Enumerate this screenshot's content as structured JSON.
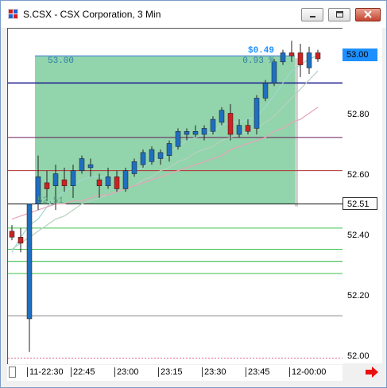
{
  "window": {
    "title": "S.CSX - CSX Corporation, 3 Min",
    "icon": "chart-app-icon",
    "controls": [
      "minimize-icon",
      "maximize-icon",
      "close-icon"
    ]
  },
  "chart": {
    "profit_label": "$0.49",
    "percent_label": "0.93 %",
    "start_price_label": "53.00",
    "entry_price_label": "52.51",
    "price_flag": "53.00",
    "last_price_flag": "52.51",
    "price_flag_color": "#1e90ff",
    "profit_zone_color": "#7fcc9e",
    "bullish_color": "#1f6fc0",
    "bearish_color": "#cc2222"
  },
  "chart_data": {
    "type": "candlestick",
    "ylim": [
      51.98,
      53.09
    ],
    "yticks": [
      "53.00",
      "52.80",
      "52.60",
      "52.40",
      "52.20",
      "52.00"
    ],
    "xticks": [
      "11-22:30",
      "22:45",
      "23:00",
      "23:15",
      "23:30",
      "23:45",
      "12-00:00"
    ],
    "candles": [
      {
        "o": 52.42,
        "h": 52.44,
        "l": 52.39,
        "c": 52.4
      },
      {
        "o": 52.4,
        "h": 52.43,
        "l": 52.35,
        "c": 52.38
      },
      {
        "o": 52.13,
        "h": 52.51,
        "l": 52.02,
        "c": 52.51
      },
      {
        "o": 52.51,
        "h": 52.67,
        "l": 52.49,
        "c": 52.6
      },
      {
        "o": 52.58,
        "h": 52.62,
        "l": 52.52,
        "c": 52.56
      },
      {
        "o": 52.57,
        "h": 52.64,
        "l": 52.49,
        "c": 52.61
      },
      {
        "o": 52.59,
        "h": 52.63,
        "l": 52.55,
        "c": 52.57
      },
      {
        "o": 52.57,
        "h": 52.64,
        "l": 52.53,
        "c": 52.62
      },
      {
        "o": 52.62,
        "h": 52.67,
        "l": 52.61,
        "c": 52.66
      },
      {
        "o": 52.63,
        "h": 52.66,
        "l": 52.6,
        "c": 52.64
      },
      {
        "o": 52.59,
        "h": 52.61,
        "l": 52.53,
        "c": 52.57
      },
      {
        "o": 52.57,
        "h": 52.63,
        "l": 52.56,
        "c": 52.6
      },
      {
        "o": 52.6,
        "h": 52.62,
        "l": 52.55,
        "c": 52.56
      },
      {
        "o": 52.56,
        "h": 52.63,
        "l": 52.55,
        "c": 52.62
      },
      {
        "o": 52.61,
        "h": 52.66,
        "l": 52.6,
        "c": 52.65
      },
      {
        "o": 52.64,
        "h": 52.69,
        "l": 52.63,
        "c": 52.68
      },
      {
        "o": 52.65,
        "h": 52.7,
        "l": 52.64,
        "c": 52.69
      },
      {
        "o": 52.66,
        "h": 52.69,
        "l": 52.64,
        "c": 52.68
      },
      {
        "o": 52.67,
        "h": 52.72,
        "l": 52.65,
        "c": 52.71
      },
      {
        "o": 52.7,
        "h": 52.76,
        "l": 52.69,
        "c": 52.75
      },
      {
        "o": 52.74,
        "h": 52.76,
        "l": 52.72,
        "c": 52.75
      },
      {
        "o": 52.74,
        "h": 52.77,
        "l": 52.73,
        "c": 52.75
      },
      {
        "o": 52.74,
        "h": 52.77,
        "l": 52.72,
        "c": 52.76
      },
      {
        "o": 52.75,
        "h": 52.8,
        "l": 52.74,
        "c": 52.79
      },
      {
        "o": 52.78,
        "h": 52.83,
        "l": 52.77,
        "c": 52.82
      },
      {
        "o": 52.81,
        "h": 52.84,
        "l": 52.72,
        "c": 52.74
      },
      {
        "o": 52.74,
        "h": 52.79,
        "l": 52.73,
        "c": 52.77
      },
      {
        "o": 52.77,
        "h": 52.79,
        "l": 52.74,
        "c": 52.75
      },
      {
        "o": 52.76,
        "h": 52.87,
        "l": 52.74,
        "c": 52.86
      },
      {
        "o": 52.86,
        "h": 52.92,
        "l": 52.85,
        "c": 52.91
      },
      {
        "o": 52.91,
        "h": 52.99,
        "l": 52.9,
        "c": 52.98
      },
      {
        "o": 52.98,
        "h": 53.02,
        "l": 52.97,
        "c": 53.01
      },
      {
        "o": 53.01,
        "h": 53.05,
        "l": 52.98,
        "c": 53.0
      },
      {
        "o": 53.01,
        "h": 53.04,
        "l": 52.93,
        "c": 52.97
      },
      {
        "o": 52.96,
        "h": 53.03,
        "l": 52.94,
        "c": 53.01
      },
      {
        "o": 53.01,
        "h": 53.02,
        "l": 52.98,
        "c": 52.99
      }
    ],
    "horizontal_lines": [
      {
        "price": 52.91,
        "color": "#1a1a8c"
      },
      {
        "price": 52.73,
        "color": "#6a1a5a"
      },
      {
        "price": 52.62,
        "color": "#b03030"
      },
      {
        "price": 52.51,
        "color": "#111111"
      },
      {
        "price": 52.43,
        "color": "#39c24a"
      },
      {
        "price": 52.36,
        "color": "#39c24a"
      },
      {
        "price": 52.32,
        "color": "#23b23a"
      },
      {
        "price": 52.28,
        "color": "#39c24a"
      },
      {
        "price": 52.14,
        "color": "#888888"
      },
      {
        "price": 52.0,
        "color": "#e07090"
      }
    ],
    "moving_averages": [
      {
        "color": "#9fd8d0",
        "values": [
          52.35,
          52.4,
          52.44,
          52.46,
          52.5,
          52.53,
          52.55,
          52.57,
          52.59,
          52.6,
          52.6,
          52.6,
          52.6,
          52.61,
          52.62,
          52.63,
          52.65,
          52.66,
          52.68,
          52.7,
          52.72,
          52.73,
          52.74,
          52.75,
          52.77,
          52.78,
          52.78,
          52.79,
          52.8,
          52.83,
          52.87,
          52.91,
          52.95,
          52.97,
          52.99,
          53.0
        ]
      },
      {
        "color": "#b8d0c0",
        "values": [
          52.36,
          52.38,
          52.4,
          52.42,
          52.44,
          52.46,
          52.47,
          52.49,
          52.51,
          52.52,
          52.53,
          52.54,
          52.55,
          52.56,
          52.57,
          52.59,
          52.6,
          52.62,
          52.63,
          52.65,
          52.66,
          52.68,
          52.69,
          52.7,
          52.72,
          52.73,
          52.74,
          52.75,
          52.76,
          52.78,
          52.8,
          52.83,
          52.86,
          52.89,
          52.92,
          52.95
        ]
      },
      {
        "color": "#e7a4b8",
        "values": [
          52.46,
          52.47,
          52.48,
          52.49,
          52.5,
          52.51,
          52.51,
          52.52,
          52.52,
          52.53,
          52.54,
          52.54,
          52.55,
          52.56,
          52.57,
          52.58,
          52.59,
          52.6,
          52.61,
          52.62,
          52.63,
          52.64,
          52.65,
          52.66,
          52.67,
          52.69,
          52.7,
          52.71,
          52.72,
          52.73,
          52.75,
          52.76,
          52.78,
          52.79,
          52.81,
          52.83
        ]
      }
    ],
    "profit_zone": {
      "from_index": 3,
      "to_index": 32,
      "low": 52.51,
      "high": 53.0
    }
  }
}
